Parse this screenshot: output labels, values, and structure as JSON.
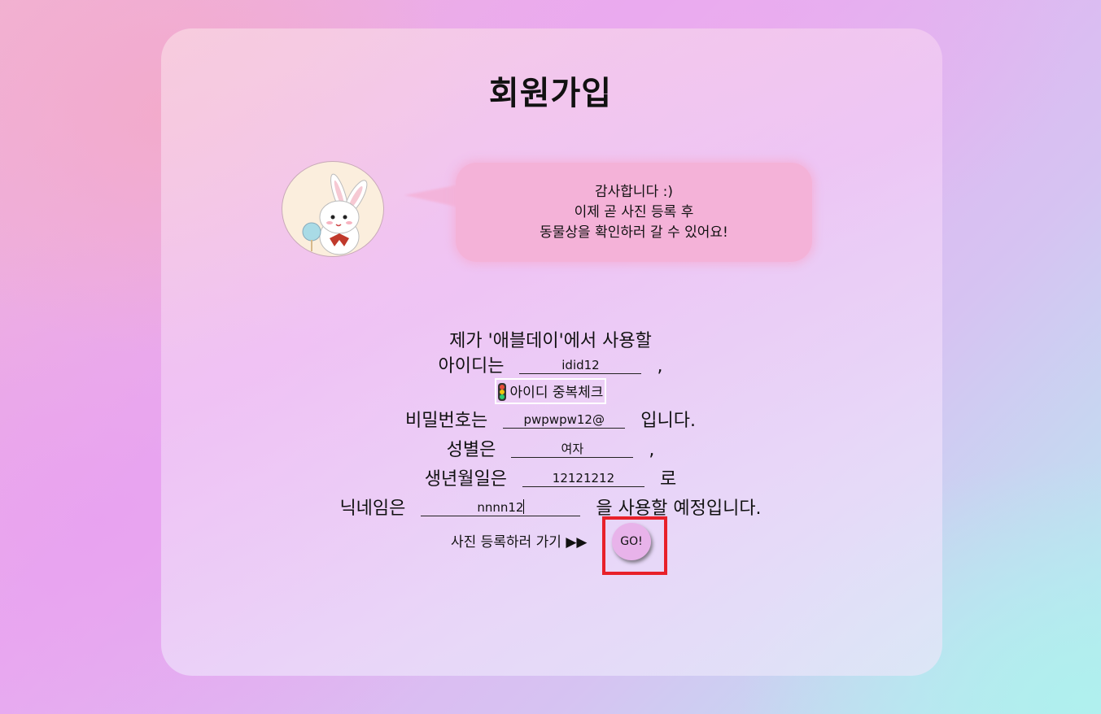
{
  "title": "회원가입",
  "bubble": {
    "line1": "감사합니다 :)",
    "line2": "이제 곧 사진 등록 후",
    "line3": "동물상을 확인하러 갈 수 있어요!"
  },
  "form": {
    "intro": "제가 '애블데이'에서 사용할",
    "id_label": "아이디는",
    "id_value": "idid12",
    "id_suffix": ",",
    "check_button": "아이디 중복체크",
    "pw_label": "비밀번호는",
    "pw_value": "pwpwpw12@",
    "pw_suffix": "입니다.",
    "gender_label": "성별은",
    "gender_value": "여자",
    "gender_suffix": ",",
    "birth_label": "생년월일은",
    "birth_value": "12121212",
    "birth_suffix": "로",
    "nick_label": "닉네임은",
    "nick_value": "nnnn12",
    "nick_suffix": "을 사용할 예정입니다."
  },
  "go": {
    "label": "사진 등록하러 가기 ▶▶",
    "button": "GO!"
  },
  "colors": {
    "bubble": "#f4b2d8",
    "go_button": "#e8b3ea",
    "highlight": "#e8202a"
  }
}
